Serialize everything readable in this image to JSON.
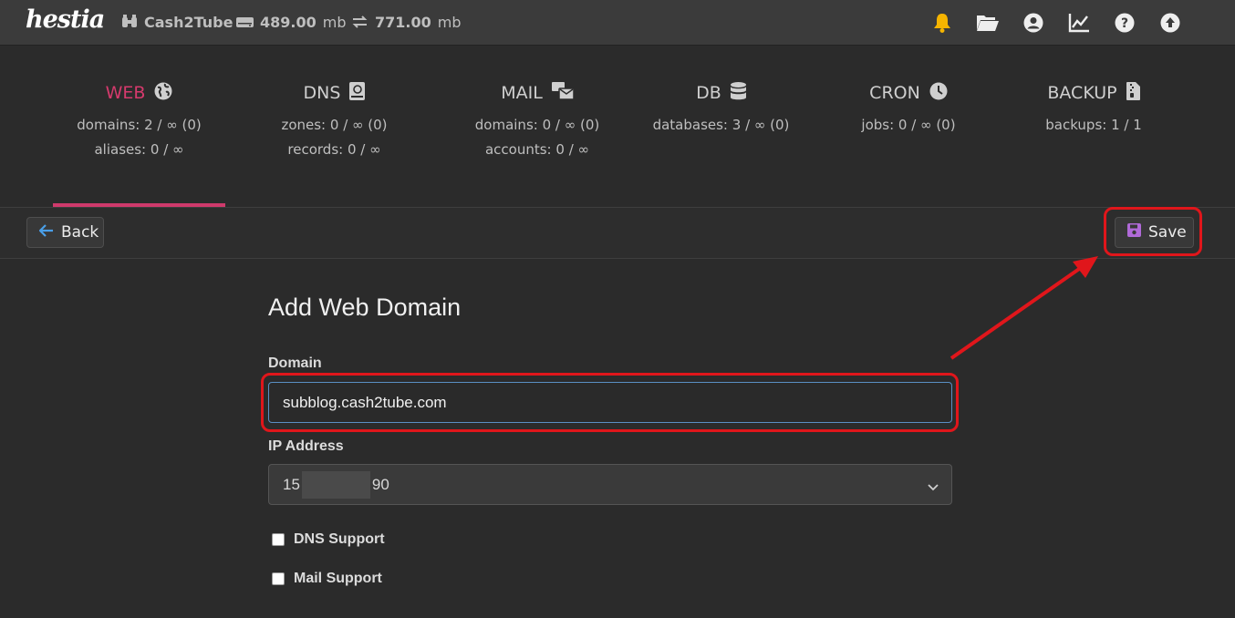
{
  "app": {
    "logo_text": "hestia",
    "user": "Cash2Tube",
    "disk": "489.00",
    "disk_unit": "mb",
    "bandwidth": "771.00",
    "bandwidth_unit": "mb"
  },
  "top_icons": [
    "bell-icon",
    "folder-icon",
    "user-icon",
    "chart-icon",
    "help-icon",
    "upload-icon"
  ],
  "tabs": [
    {
      "label": "WEB",
      "icon": "globe-icon",
      "lines": [
        "domains: 2 / ∞ (0)",
        "aliases: 0 / ∞"
      ]
    },
    {
      "label": "DNS",
      "icon": "atlas-icon",
      "lines": [
        "zones: 0 / ∞ (0)",
        "records: 0 / ∞"
      ]
    },
    {
      "label": "MAIL",
      "icon": "mail-bulk-icon",
      "lines": [
        "domains: 0 / ∞ (0)",
        "accounts: 0 / ∞"
      ]
    },
    {
      "label": "DB",
      "icon": "database-icon",
      "lines": [
        "databases: 3 / ∞ (0)"
      ]
    },
    {
      "label": "CRON",
      "icon": "clock-icon",
      "lines": [
        "jobs: 0 / ∞ (0)"
      ]
    },
    {
      "label": "BACKUP",
      "icon": "file-zipper-icon",
      "lines": [
        "backups: 1 / 1"
      ]
    }
  ],
  "toolbar": {
    "back_label": "Back",
    "save_label": "Save"
  },
  "form": {
    "title": "Add Web Domain",
    "domain_label": "Domain",
    "domain_value": "subblog.cash2tube.com",
    "ip_label": "IP Address",
    "ip_prefix": "15",
    "ip_suffix": "90",
    "dns_label": "DNS Support",
    "mail_label": "Mail Support"
  },
  "colors": {
    "accent": "#d63a6d",
    "highlight": "#e0161b",
    "save_icon": "#b06ad8",
    "back_icon": "#4a9fe8",
    "bell": "#f5b400"
  }
}
